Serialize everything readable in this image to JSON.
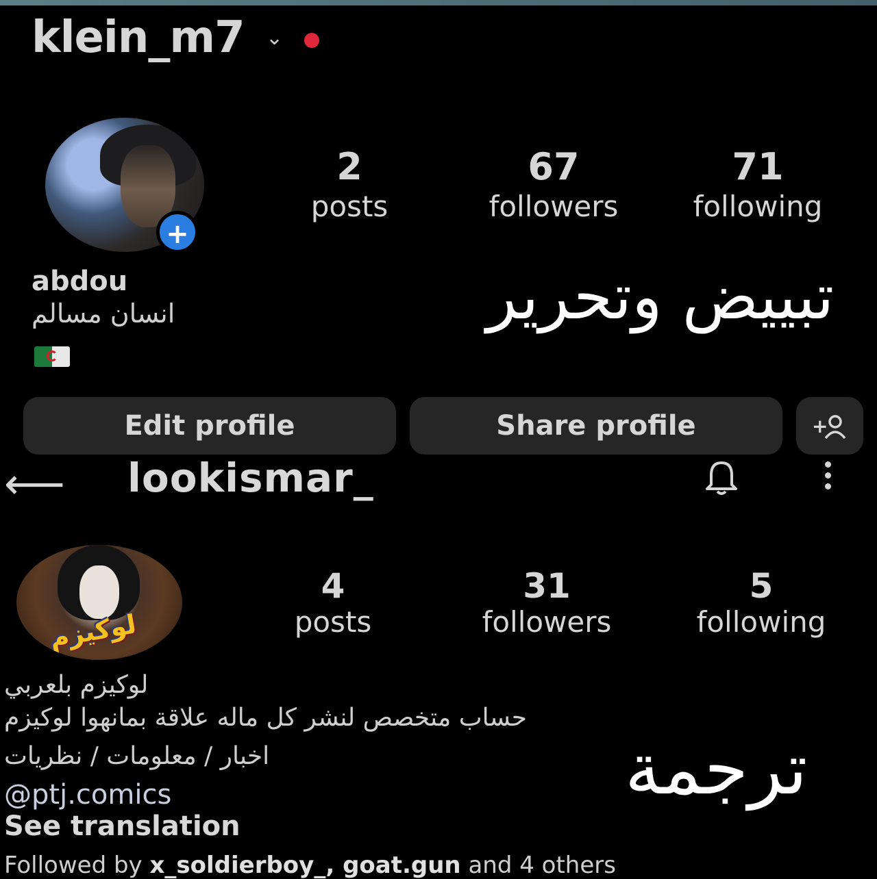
{
  "profile1": {
    "username": "klein_m7",
    "stats": [
      {
        "num": "2",
        "label": "posts"
      },
      {
        "num": "67",
        "label": "followers"
      },
      {
        "num": "71",
        "label": "following"
      }
    ],
    "name": "abdou",
    "bio": "انسان مسالم",
    "edit_label": "Edit profile",
    "share_label": "Share profile",
    "add_user_label": "+👤"
  },
  "overlay_text_1": "تبييض وتحرير",
  "overlay_text_2": "ترجمة",
  "profile2": {
    "username": "lookismar_",
    "stats": [
      {
        "num": "4",
        "label": "posts"
      },
      {
        "num": "31",
        "label": "followers"
      },
      {
        "num": "5",
        "label": "following"
      }
    ],
    "avatar_logo_text": "لوكيزم",
    "bio_lines": [
      "لوكيزم بلعربي",
      "حساب متخصص لنشر كل ماله علاقة بمانهوا لوكيزم",
      "اخبار / معلومات / نظريات"
    ],
    "link": "@ptj.comics",
    "see_translation": "See translation",
    "followed_prefix": "Followed by ",
    "followed_names": "x_soldierboy_, goat.gun",
    "followed_suffix": " and 4 others"
  },
  "colors": {
    "background": "#000000",
    "button_bg": "#262626",
    "badge_blue": "#2a7de1",
    "notification_red": "#e0283a"
  }
}
